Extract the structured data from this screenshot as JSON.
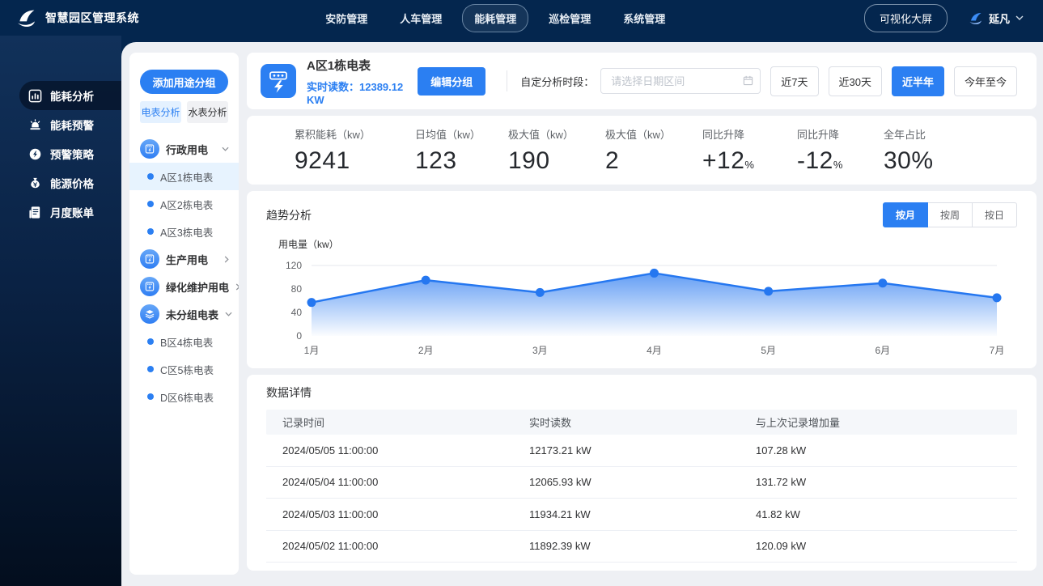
{
  "topbar": {
    "title": "智慧园区管理系统",
    "nav": [
      {
        "label": "安防管理",
        "active": false
      },
      {
        "label": "人车管理",
        "active": false
      },
      {
        "label": "能耗管理",
        "active": true
      },
      {
        "label": "巡检管理",
        "active": false
      },
      {
        "label": "系统管理",
        "active": false
      }
    ],
    "screen_button": "可视化大屏",
    "user_name": "延凡"
  },
  "sidebar": {
    "items": [
      {
        "label": "能耗分析",
        "active": true
      },
      {
        "label": "能耗预警",
        "active": false
      },
      {
        "label": "预警策略",
        "active": false
      },
      {
        "label": "能源价格",
        "active": false
      },
      {
        "label": "月度账单",
        "active": false
      }
    ]
  },
  "panel": {
    "add_group_button": "添加用途分组",
    "tabs": [
      {
        "label": "电表分析",
        "active": true
      },
      {
        "label": "水表分析",
        "active": false
      }
    ],
    "tree": {
      "groups": [
        {
          "label": "行政用电",
          "expanded": true,
          "children": [
            "A区1栋电表",
            "A区2栋电表",
            "A区3栋电表"
          ],
          "selected_child": "A区1栋电表"
        },
        {
          "label": "生产用电",
          "expanded": false
        },
        {
          "label": "绿化维护用电",
          "expanded": false
        },
        {
          "label": "未分组电表",
          "expanded": true,
          "children": [
            "B区4栋电表",
            "C区5栋电表",
            "D区6栋电表"
          ]
        }
      ]
    }
  },
  "header": {
    "meter_title": "A区1栋电表",
    "reading_label": "实时读数：",
    "reading_value": "12389.12 KW",
    "edit_group_button": "编辑分组",
    "period_label": "自定分析时段：",
    "date_placeholder": "请选择日期区间",
    "range_buttons": [
      {
        "label": "近7天",
        "active": false
      },
      {
        "label": "近30天",
        "active": false
      },
      {
        "label": "近半年",
        "active": true
      },
      {
        "label": "今年至今",
        "active": false
      }
    ]
  },
  "stats": [
    {
      "label": "累积能耗（kw）",
      "value": "9241"
    },
    {
      "label": "日均值（kw）",
      "value": "123"
    },
    {
      "label": "极大值（kw）",
      "value": "190"
    },
    {
      "label": "极大值（kw）",
      "value": "2"
    },
    {
      "label": "同比升降",
      "value": "+12",
      "suffix": "%"
    },
    {
      "label": "同比升降",
      "value": "-12",
      "suffix": "%"
    },
    {
      "label": "全年占比",
      "value": "30%"
    }
  ],
  "trend": {
    "title": "趋势分析",
    "buttons": [
      {
        "label": "按月",
        "active": true
      },
      {
        "label": "按周",
        "active": false
      },
      {
        "label": "按日",
        "active": false
      }
    ]
  },
  "chart_data": {
    "type": "area",
    "title": "趋势分析",
    "x": [
      "1月",
      "2月",
      "3月",
      "4月",
      "5月",
      "6月",
      "7月"
    ],
    "values": [
      57,
      95,
      74,
      107,
      76,
      90,
      65
    ],
    "ylabel": "用电量（kw）",
    "xlabel": "",
    "ylim": [
      0,
      120
    ],
    "yticks": [
      0,
      40,
      80,
      120
    ],
    "grid": "top-line-only",
    "legend": "none",
    "line_color": "#2577f0"
  },
  "table": {
    "title": "数据详情",
    "columns": [
      "记录时间",
      "实时读数",
      "与上次记录增加量"
    ],
    "rows": [
      {
        "time": "2024/05/05 11:00:00",
        "reading": "12173.21 kW",
        "delta": "107.28 kW"
      },
      {
        "time": "2024/05/04 11:00:00",
        "reading": "12065.93 kW",
        "delta": "131.72 kW"
      },
      {
        "time": "2024/05/03 11:00:00",
        "reading": "11934.21 kW",
        "delta": "41.82 kW"
      },
      {
        "time": "2024/05/02 11:00:00",
        "reading": "11892.39 kW",
        "delta": "120.09 kW"
      }
    ]
  },
  "colors": {
    "accent_blue": "#2b7ff2",
    "navy": "#04264e",
    "selected_row": "#e7f3fe",
    "page_bg": "#eef0f4",
    "table_header_bg": "#f5f7fa"
  }
}
